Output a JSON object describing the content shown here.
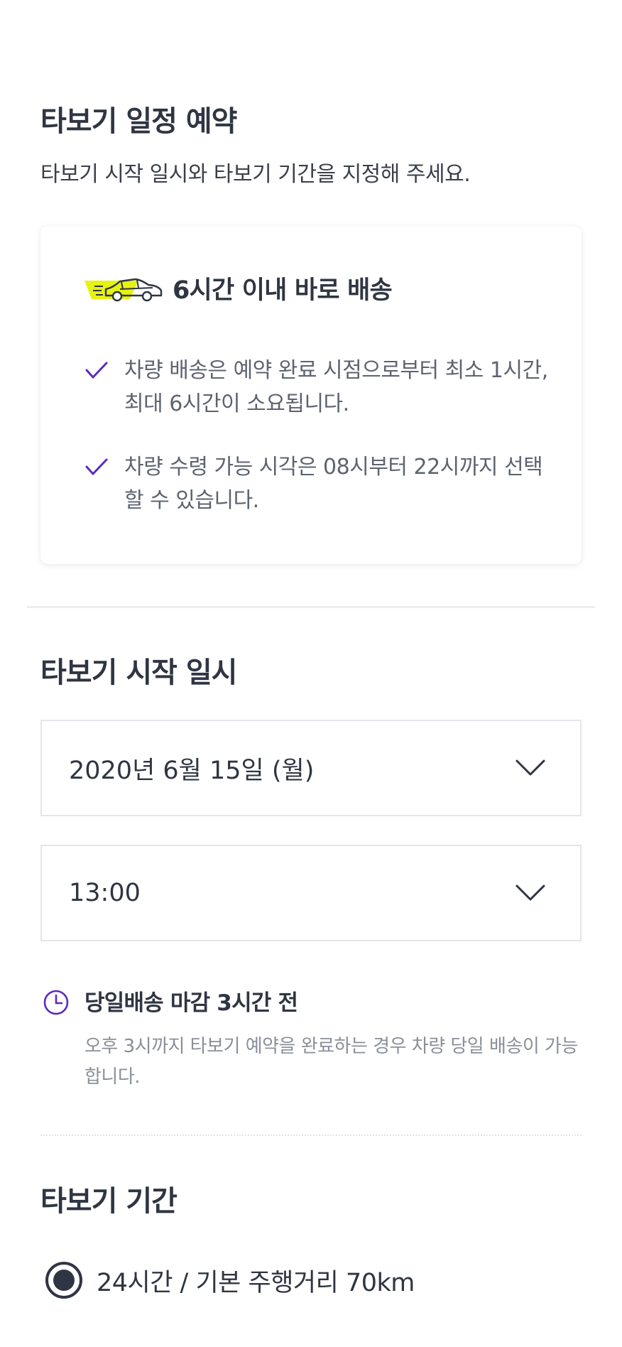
{
  "header": {
    "title": "타보기 일정 예약",
    "subtitle": "타보기 시작 일시와 타보기 기간을 지정해 주세요."
  },
  "info_card": {
    "icon": "car-delivery-icon",
    "title": "6시간 이내 바로 배송",
    "bullets": [
      {
        "icon": "check-icon",
        "text": "차량 배송은 예약 완료 시점으로부터 최소 1시간, 최대 6시간이 소요됩니다."
      },
      {
        "icon": "check-icon",
        "text": "차량 수령 가능 시각은 08시부터 22시까지 선택할 수 있습니다."
      }
    ],
    "accent_color": "#e6f213",
    "check_color": "#5b2bbf"
  },
  "start": {
    "title": "타보기 시작 일시",
    "date_value": "2020년 6월 15일 (월)",
    "time_value": "13:00",
    "notice": {
      "icon": "clock-icon",
      "title": "당일배송 마감 3시간 전",
      "body": "오후 3시까지 타보기 예약을 완료하는 경우 차량 당일 배송이 가능합니다.",
      "icon_color": "#5b2bbf"
    }
  },
  "period": {
    "title": "타보기 기간",
    "options": [
      {
        "label": "24시간 / 기본 주행거리 70km",
        "selected": true
      }
    ]
  }
}
